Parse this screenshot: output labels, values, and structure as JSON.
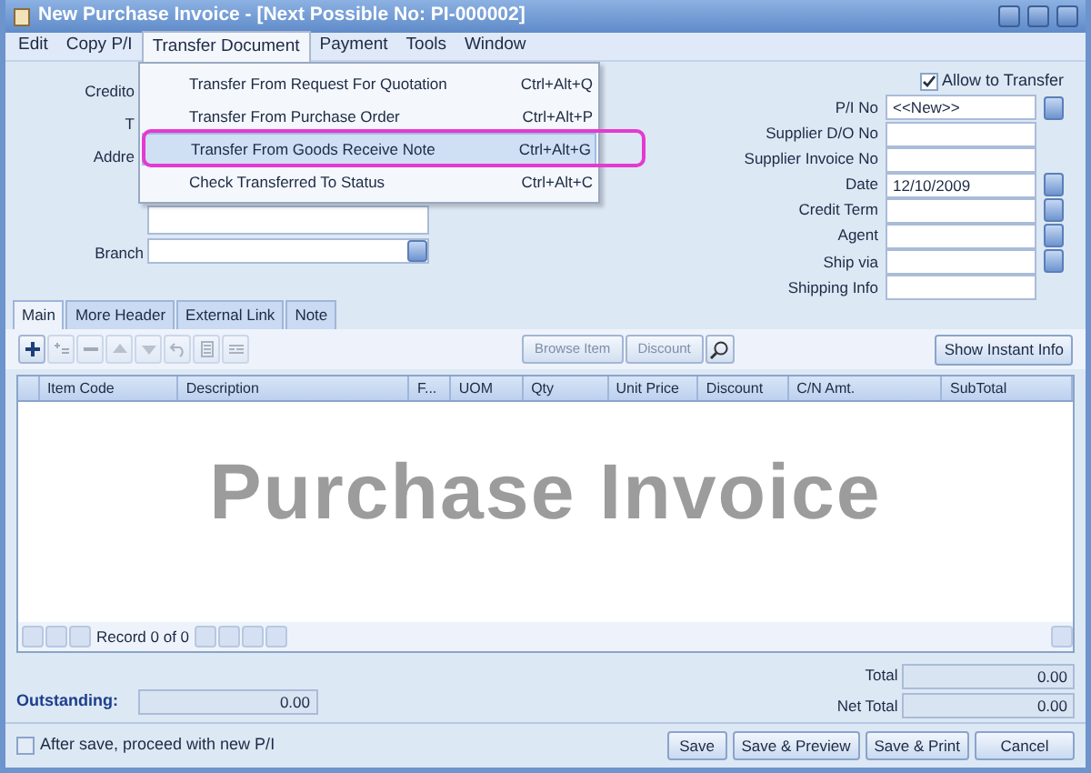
{
  "window": {
    "title": "New Purchase Invoice - [Next Possible No: PI-000002]"
  },
  "menu_bar": [
    {
      "label": "Edit",
      "selected": false
    },
    {
      "label": "Copy P/I",
      "selected": false
    },
    {
      "label": "Transfer Document",
      "selected": true
    },
    {
      "label": "Payment",
      "selected": false
    },
    {
      "label": "Tools",
      "selected": false
    },
    {
      "label": "Window",
      "selected": false
    }
  ],
  "dropdown": [
    {
      "label": "Transfer From Request For Quotation",
      "shortcut": "Ctrl+Alt+Q",
      "highlighted": false
    },
    {
      "label": "Transfer From Purchase Order",
      "shortcut": "Ctrl+Alt+P",
      "highlighted": false
    },
    {
      "label": "Transfer From Goods Receive Note",
      "shortcut": "Ctrl+Alt+G",
      "highlighted": true
    },
    {
      "label": "Check Transferred To Status",
      "shortcut": "Ctrl+Alt+C",
      "highlighted": false
    }
  ],
  "header_left": {
    "labels": [
      "Credito",
      "T",
      "Addre"
    ],
    "branch_label": "Branch"
  },
  "allow_transfer": {
    "label": "Allow to Transfer",
    "checked": true
  },
  "header_right": [
    {
      "label": "P/I No",
      "value": "<<New>>",
      "dropdown": true
    },
    {
      "label": "Supplier D/O No",
      "dropdown": false
    },
    {
      "label": "Supplier Invoice No",
      "dropdown": false
    },
    {
      "label": "Date",
      "value": "12/10/2009",
      "dropdown": true
    },
    {
      "label": "Credit Term",
      "dropdown": true
    },
    {
      "label": "Agent",
      "dropdown": true
    },
    {
      "label": "Ship via",
      "dropdown": true
    },
    {
      "label": "Shipping Info",
      "dropdown": false
    }
  ],
  "tabs": [
    {
      "label": "Main",
      "selected": true
    },
    {
      "label": "More Header",
      "selected": false
    },
    {
      "label": "External Link",
      "selected": false
    },
    {
      "label": "Note",
      "selected": false
    }
  ],
  "toolbar": [
    {
      "kind": "add",
      "disabled": false
    },
    {
      "kind": "insert",
      "disabled": true
    },
    {
      "kind": "remove",
      "disabled": true
    },
    {
      "kind": "up",
      "disabled": true
    },
    {
      "kind": "down",
      "disabled": true
    },
    {
      "kind": "undo",
      "disabled": true
    },
    {
      "kind": "list",
      "disabled": true
    },
    {
      "kind": "detail",
      "disabled": true
    }
  ],
  "grid_buttons": [
    {
      "label": "Browse Item",
      "disabled": true
    },
    {
      "label": "Discount",
      "disabled": true
    }
  ],
  "show_instant_info": "Show Instant Info",
  "table": {
    "columns": [
      "Item Code",
      "Description",
      "F...",
      "UOM",
      "Qty",
      "Unit Price",
      "Discount",
      "C/N Amt.",
      "SubTotal"
    ]
  },
  "overlay_caption": "Purchase Invoice",
  "navigator": {
    "record": "Record 0 of 0"
  },
  "outstanding": {
    "label": "Outstanding:",
    "value": "0.00"
  },
  "totals": [
    {
      "label": "Total",
      "value": "0.00"
    },
    {
      "label": "Net Total",
      "value": "0.00"
    }
  ],
  "proceed": {
    "label": "After save, proceed with new P/I",
    "checked": false
  },
  "buttons": [
    "Save",
    "Save & Preview",
    "Save & Print",
    "Cancel"
  ]
}
